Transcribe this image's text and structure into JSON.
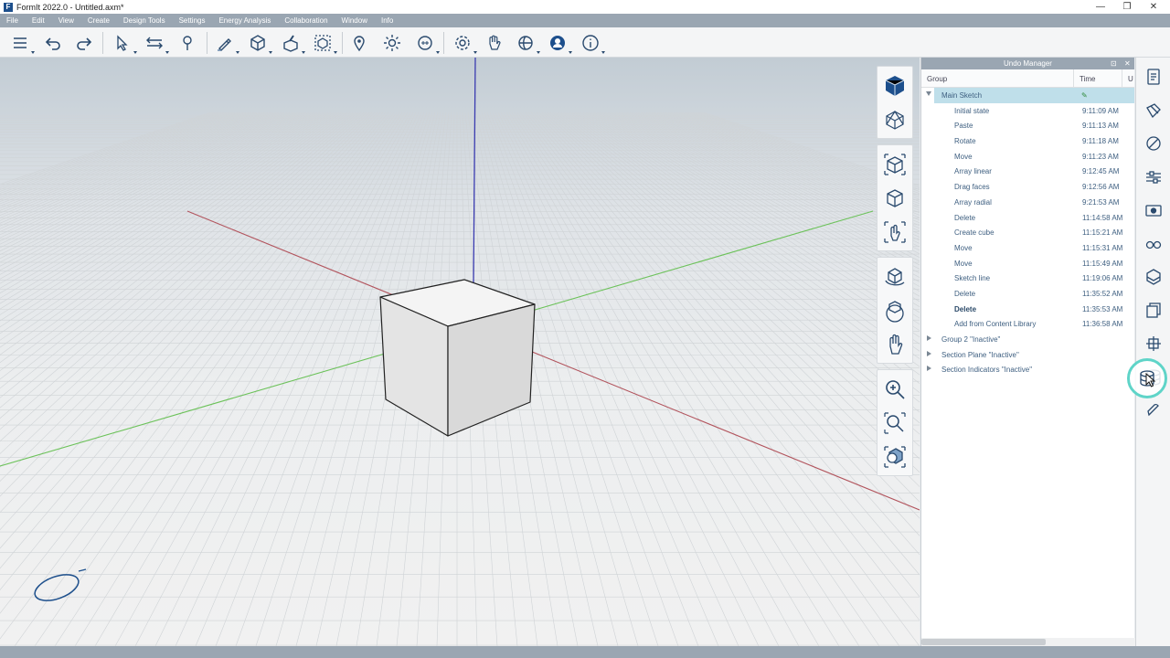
{
  "window": {
    "title": "FormIt 2022.0 - Untitled.axm*",
    "logo_letter": "F",
    "controls": {
      "minimize": "—",
      "restore": "❐",
      "close": "✕"
    }
  },
  "menu": [
    "File",
    "Edit",
    "View",
    "Create",
    "Design Tools",
    "Settings",
    "Energy Analysis",
    "Collaboration",
    "Window",
    "Info"
  ],
  "toolbar_icons": [
    "layers-icon",
    "undo-icon",
    "redo-icon",
    "select-icon",
    "move-align-icon",
    "paint-icon",
    "sketch-pen-icon",
    "cube-primitive-icon",
    "edit-tools-icon",
    "group-icon",
    "location-pin-icon",
    "sun-icon",
    "camera-icon",
    "settings-gear-icon",
    "pan-hand-icon",
    "globe-share-icon",
    "user-profile-icon",
    "info-icon"
  ],
  "nav_icons": [
    "home-view-icon",
    "orthographic-view-icon",
    "view-cube-top-icon",
    "view-cube-iso-icon",
    "look-at-icon",
    "orbit-icon",
    "orbit-model-icon",
    "pan-icon",
    "zoom-icon",
    "zoom-window-icon",
    "zoom-extents-icon"
  ],
  "undo_manager": {
    "title": "Undo Manager",
    "pin": "⊡",
    "close": "✕",
    "columns": {
      "group": "Group",
      "time": "Time",
      "user": "U"
    },
    "groups": [
      {
        "name": "Main Sketch",
        "expanded": true,
        "selected": true,
        "edit_icon": "✎"
      },
      {
        "name": "Group 2 \"Inactive\"",
        "expanded": false
      },
      {
        "name": "Section Plane \"Inactive\"",
        "expanded": false
      },
      {
        "name": "Section Indicators \"Inactive\"",
        "expanded": false
      }
    ],
    "entries": [
      {
        "action": "Initial state",
        "time": "9:11:09 AM"
      },
      {
        "action": "Paste",
        "time": "9:11:13 AM"
      },
      {
        "action": "Rotate",
        "time": "9:11:18 AM"
      },
      {
        "action": "Move",
        "time": "9:11:23 AM"
      },
      {
        "action": "Array linear",
        "time": "9:12:45 AM"
      },
      {
        "action": "Drag faces",
        "time": "9:12:56 AM"
      },
      {
        "action": "Array radial",
        "time": "9:21:53 AM"
      },
      {
        "action": "Delete",
        "time": "11:14:58 AM"
      },
      {
        "action": "Create cube",
        "time": "11:15:21 AM"
      },
      {
        "action": "Move",
        "time": "11:15:31 AM"
      },
      {
        "action": "Move",
        "time": "11:15:49 AM"
      },
      {
        "action": "Sketch line",
        "time": "11:19:06 AM"
      },
      {
        "action": "Delete",
        "time": "11:35:52 AM"
      },
      {
        "action": "Delete",
        "time": "11:35:53 AM",
        "current": true
      },
      {
        "action": "Add from Content Library",
        "time": "11:36:58 AM"
      }
    ]
  },
  "sidebar_icons": [
    "properties-icon",
    "materials-icon",
    "content-library-icon",
    "layers-panel-icon",
    "scenes-icon",
    "visual-styles-icon",
    "levels-icon",
    "groups-panel-icon",
    "plugins-icon",
    "undo-manager-icon",
    "dynamo-icon"
  ],
  "colors": {
    "x_axis": "#b2545d",
    "y_axis": "#6cc25a",
    "z_axis": "#3a3bb0",
    "accent_blue": "#1d4f8c",
    "selection": "#bfdfea",
    "highlight_ring": "#5fd4c8"
  }
}
